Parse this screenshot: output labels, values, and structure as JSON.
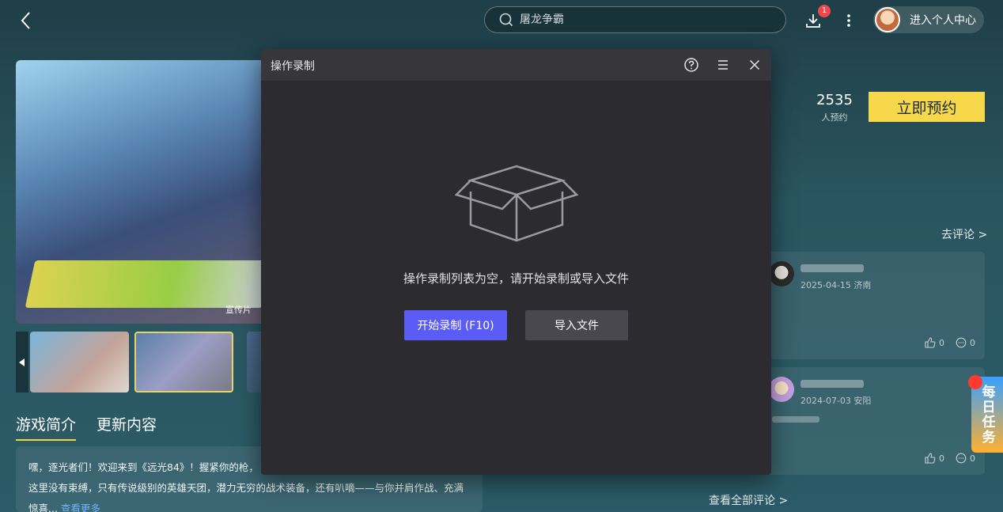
{
  "search": {
    "placeholder": "屠龙争霸"
  },
  "header": {
    "download_badge": "1",
    "user_center_label": "进入个人中心"
  },
  "media": {
    "hero_tag": "宣传片"
  },
  "tabs": [
    {
      "label": "游戏简介"
    },
    {
      "label": "更新内容"
    }
  ],
  "intro": {
    "line1": "嘿，逐光者们！欢迎来到《远光84》！握紧你的枪，",
    "line2": "这里没有束缚，只有传说级别的英雄天团，潜力无穷的战术装备，还有叭嘀——与你并肩作战、充满",
    "line3": "惊喜...",
    "more_link": "查看更多"
  },
  "reservation": {
    "count": "2535",
    "count_label": "人预约",
    "button_label": "立即预约"
  },
  "comments": {
    "goto_label": "去评论 >",
    "items": [
      {
        "meta": "2025-04-15 济南",
        "likes": "0",
        "replies": "0"
      },
      {
        "meta": "2024-07-03 安阳",
        "likes": "0",
        "replies": "0"
      }
    ],
    "see_all_label": "查看全部评论 >"
  },
  "daily_task": {
    "label": "每日任务"
  },
  "modal": {
    "title": "操作录制",
    "empty_text": "操作录制列表为空，请开始录制或导入文件",
    "record_button": "开始录制 (F10)",
    "import_button": "导入文件"
  },
  "colors": {
    "accent": "#5b5cf5",
    "reserve": "#f6d84a",
    "badge": "#f0464c"
  },
  "icons": [
    "back-icon",
    "search-icon",
    "download-icon",
    "more-vertical-icon",
    "help-icon",
    "menu-icon",
    "close-icon",
    "empty-box-icon",
    "thumb-up-icon",
    "comment-icon",
    "chevron-left-icon"
  ]
}
